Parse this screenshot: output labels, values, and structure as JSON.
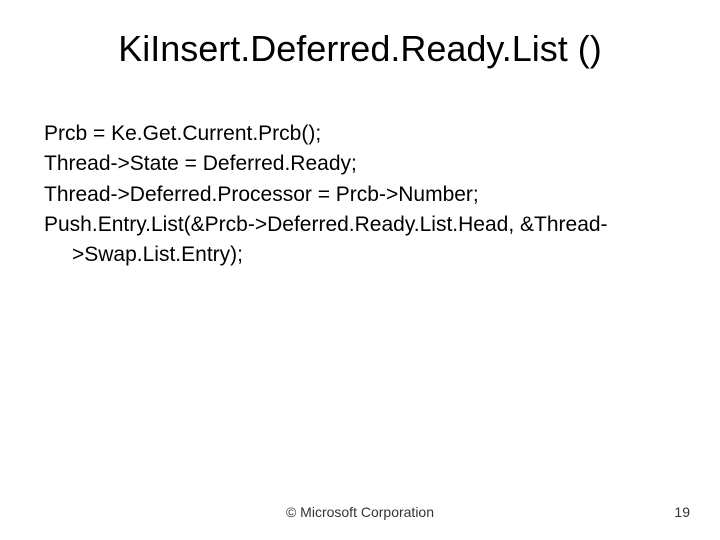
{
  "title": "KiInsert.Deferred.Ready.List ()",
  "lines": [
    "Prcb = Ke.Get.Current.Prcb();",
    "Thread->State = Deferred.Ready;",
    "Thread->Deferred.Processor = Prcb->Number;",
    "Push.Entry.List(&Prcb->Deferred.Ready.List.Head, &Thread-",
    ">Swap.List.Entry);"
  ],
  "footer": {
    "copyright": "© Microsoft Corporation",
    "page": "19"
  }
}
